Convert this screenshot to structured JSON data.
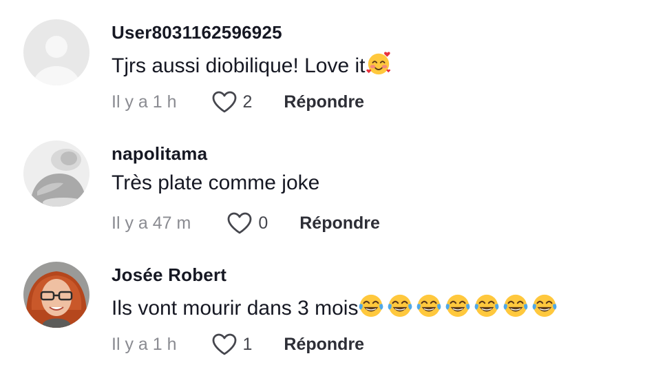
{
  "comments": [
    {
      "username": "User8031162596925",
      "text": "Tjrs aussi diobilique! Love it",
      "emoji_icon": "smiling-face-with-hearts-icon",
      "emoji_count": 1,
      "time": "Il y a 1 h",
      "likes": "2",
      "reply_label": "Répondre",
      "avatar": "default-avatar"
    },
    {
      "username": "napolitama",
      "text": "Très plate comme joke",
      "emoji_icon": "",
      "emoji_count": 0,
      "time": "Il y a 47 m",
      "likes": "0",
      "reply_label": "Répondre",
      "avatar": "grayscale-photo-avatar"
    },
    {
      "username": "Josée Robert",
      "text": "Ils vont mourir dans 3 mois",
      "emoji_icon": "face-with-tears-of-joy-icon",
      "emoji_count": 7,
      "time": "Il y a 1 h",
      "likes": "1",
      "reply_label": "Répondre",
      "avatar": "redhead-glasses-photo-avatar"
    }
  ],
  "colors": {
    "text": "#161823",
    "secondary": "#8a8b91",
    "icon": "#45464d"
  }
}
